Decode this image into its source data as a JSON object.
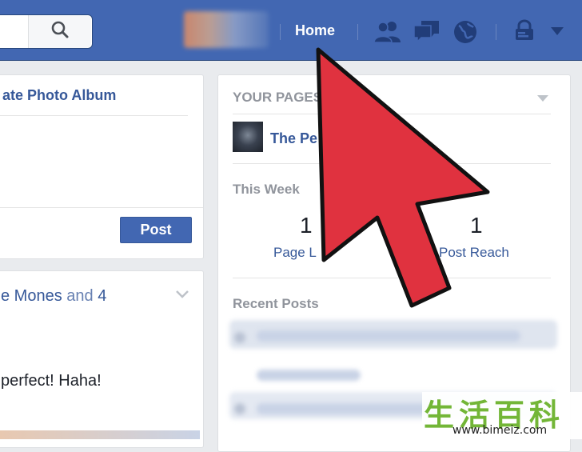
{
  "topbar": {
    "nav": {
      "home_label": "Home"
    },
    "icons": [
      "search-icon",
      "friends-icon",
      "messages-icon",
      "notifications-globe-icon",
      "privacy-lock-icon",
      "account-menu-chevron-icon"
    ]
  },
  "composer": {
    "album_link": "ate Photo Album",
    "post_button": "Post"
  },
  "feed_story": {
    "person": "e Mones",
    "conjunction": " and ",
    "others": "4",
    "status": "perfect! Haha!"
  },
  "pages_panel": {
    "header": "YOUR PAGES",
    "page_name": "The Pe",
    "this_week": {
      "title": "This Week",
      "page_likes_value": "1",
      "page_likes_label": "Page L",
      "post_reach_value": "1",
      "post_reach_label": "Post Reach"
    },
    "recent_posts_title": "Recent Posts"
  },
  "watermark": {
    "chars": "生活百科",
    "url": "www.bimeiz.com"
  },
  "colors": {
    "topbar": "#4267b2",
    "link": "#365899",
    "arrow": "#e0323f",
    "watermark": "#73b637"
  }
}
